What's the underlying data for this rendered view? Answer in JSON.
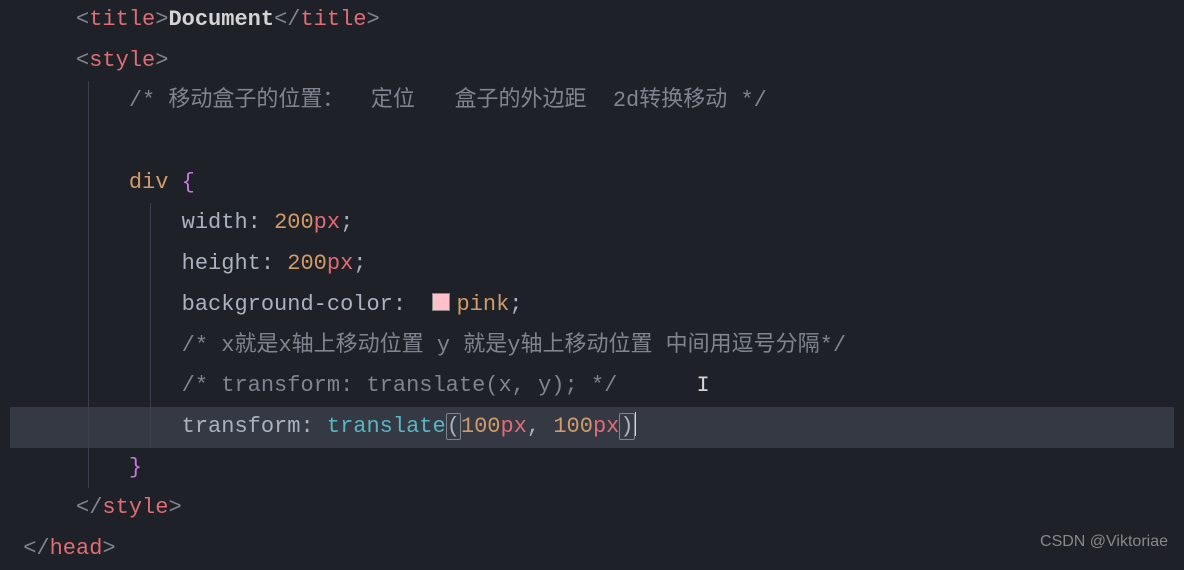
{
  "watermark": "CSDN @Viktoriae",
  "code": {
    "line1": {
      "tag_open": "<",
      "tag_title": "title",
      "close": ">",
      "content": "Document",
      "tag_close_open": "</",
      "tag_close": "title",
      "tag_close_end": ">"
    },
    "line2": {
      "tag_open": "<",
      "tag": "style",
      "close": ">"
    },
    "line3": {
      "comment": "/* 移动盒子的位置：  定位   盒子的外边距  2d转换移动 */"
    },
    "line5": {
      "selector": "div",
      "brace": " {"
    },
    "line6": {
      "prop": "width",
      "colon": ": ",
      "num": "200",
      "unit": "px",
      "semi": ";"
    },
    "line7": {
      "prop": "height",
      "colon": ": ",
      "num": "200",
      "unit": "px",
      "semi": ";"
    },
    "line8": {
      "prop": "background-color",
      "colon": ":  ",
      "color": "pink",
      "semi": ";"
    },
    "line9": {
      "comment": "/* x就是x轴上移动位置 y 就是y轴上移动位置 中间用逗号分隔*/"
    },
    "line10": {
      "comment": "/* transform: translate(x, y); */"
    },
    "line11": {
      "prop": "transform",
      "colon": ": ",
      "func": "translate",
      "paren_open": "(",
      "arg1_num": "100",
      "arg1_unit": "px",
      "comma": ", ",
      "arg2_num": "100",
      "arg2_unit": "px",
      "paren_close": ")"
    },
    "line12": {
      "brace": "}"
    },
    "line13": {
      "tag_open": "</",
      "tag": "style",
      "close": ">"
    },
    "line14": {
      "tag_open": "</",
      "tag": "head",
      "close": ">"
    }
  }
}
